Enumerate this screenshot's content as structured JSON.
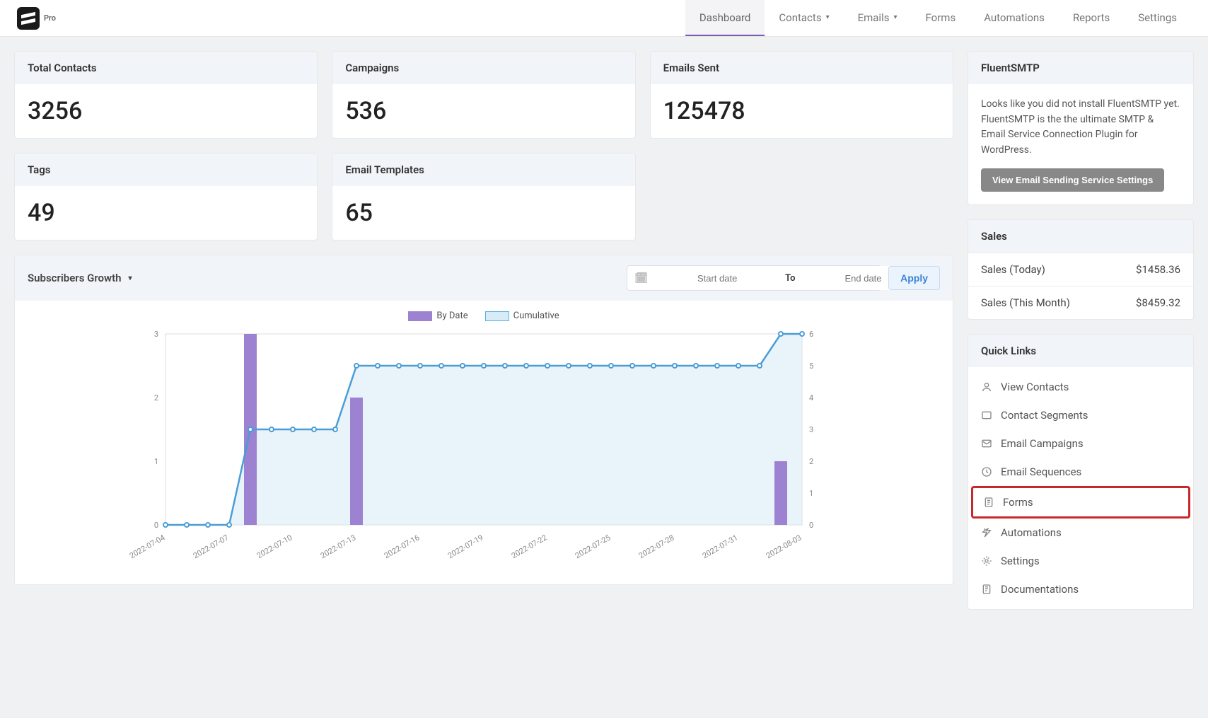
{
  "header": {
    "pro": "Pro",
    "nav": [
      "Dashboard",
      "Contacts",
      "Emails",
      "Forms",
      "Automations",
      "Reports",
      "Settings"
    ]
  },
  "stats": {
    "total_contacts": {
      "label": "Total Contacts",
      "value": "3256"
    },
    "campaigns": {
      "label": "Campaigns",
      "value": "536"
    },
    "emails_sent": {
      "label": "Emails Sent",
      "value": "125478"
    },
    "tags": {
      "label": "Tags",
      "value": "49"
    },
    "email_templates": {
      "label": "Email Templates",
      "value": "65"
    }
  },
  "chart": {
    "title": "Subscribers Growth",
    "start_ph": "Start date",
    "end_ph": "End date",
    "to": "To",
    "apply": "Apply",
    "legend_bar": "By Date",
    "legend_line": "Cumulative"
  },
  "chart_data": {
    "type": "bar+line",
    "x_labels": [
      "2022-07-04",
      "2022-07-07",
      "2022-07-10",
      "2022-07-13",
      "2022-07-16",
      "2022-07-19",
      "2022-07-22",
      "2022-07-25",
      "2022-07-28",
      "2022-07-31",
      "2022-08-03"
    ],
    "left_axis": {
      "min": 0,
      "max": 3,
      "ticks": [
        0,
        1,
        2,
        3
      ]
    },
    "right_axis": {
      "min": 0,
      "max": 6,
      "ticks": [
        0,
        1,
        2,
        3,
        4,
        5,
        6
      ]
    },
    "by_date": [
      0,
      0,
      0,
      0,
      3,
      0,
      0,
      0,
      0,
      2,
      0,
      0,
      0,
      0,
      0,
      0,
      0,
      0,
      0,
      0,
      0,
      0,
      0,
      0,
      0,
      0,
      0,
      0,
      0,
      1,
      0
    ],
    "cumulative": [
      0,
      0,
      0,
      0,
      3,
      3,
      3,
      3,
      3,
      5,
      5,
      5,
      5,
      5,
      5,
      5,
      5,
      5,
      5,
      5,
      5,
      5,
      5,
      5,
      5,
      5,
      5,
      5,
      5,
      6,
      6
    ]
  },
  "fluentsmtp": {
    "title": "FluentSMTP",
    "body": "Looks like you did not install FluentSMTP yet. FluentSMTP is the the ultimate SMTP & Email Service Connection Plugin for WordPress.",
    "button": "View Email Sending Service Settings"
  },
  "sales": {
    "title": "Sales",
    "today_label": "Sales (Today)",
    "today_value": "$1458.36",
    "month_label": "Sales (This Month)",
    "month_value": "$8459.32"
  },
  "quick_links": {
    "title": "Quick Links",
    "items": [
      "View Contacts",
      "Contact Segments",
      "Email Campaigns",
      "Email Sequences",
      "Forms",
      "Automations",
      "Settings",
      "Documentations"
    ]
  }
}
